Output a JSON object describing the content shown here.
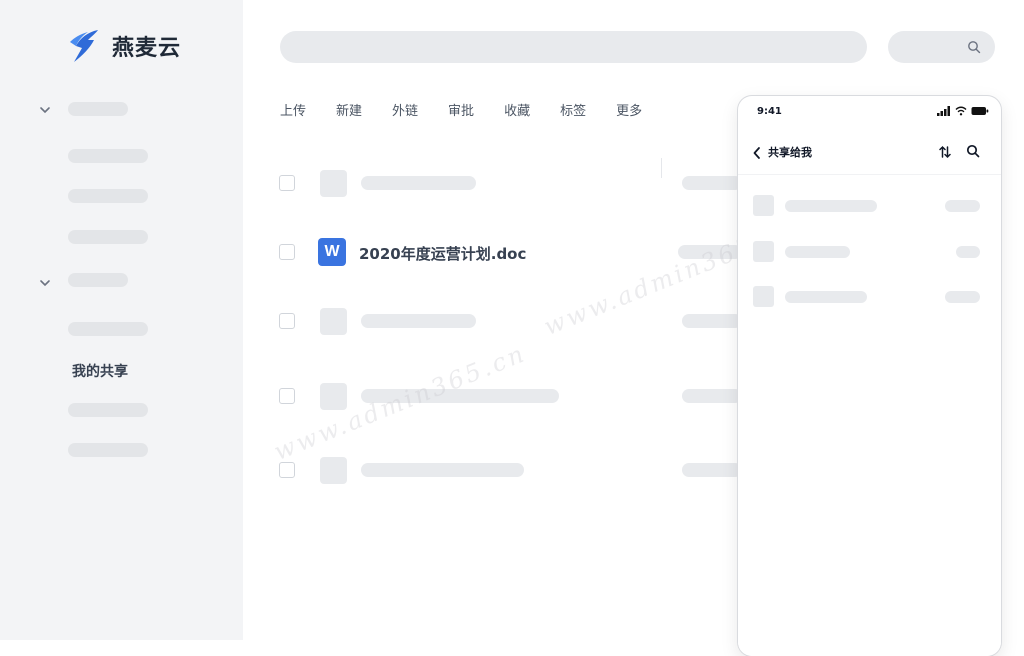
{
  "app": {
    "name": "燕麦云",
    "brand_color": "#2f6bd8"
  },
  "sidebar": {
    "shared_label": "我的共享"
  },
  "toolbar": {
    "items": [
      "上传",
      "新建",
      "外链",
      "审批",
      "收藏",
      "标签",
      "更多"
    ]
  },
  "file": {
    "name": "2020年度运营计划.doc",
    "type_letter": "W",
    "icon_color": "#3a74e0"
  },
  "watermark": {
    "text": "www.admin365.cn"
  },
  "phone": {
    "time": "9:41",
    "title": "共享给我"
  },
  "icons": [
    "logo-icon",
    "chevron-down-icon",
    "search-icon",
    "back-icon",
    "sort-icon",
    "signal-icon",
    "wifi-icon",
    "battery-icon"
  ]
}
